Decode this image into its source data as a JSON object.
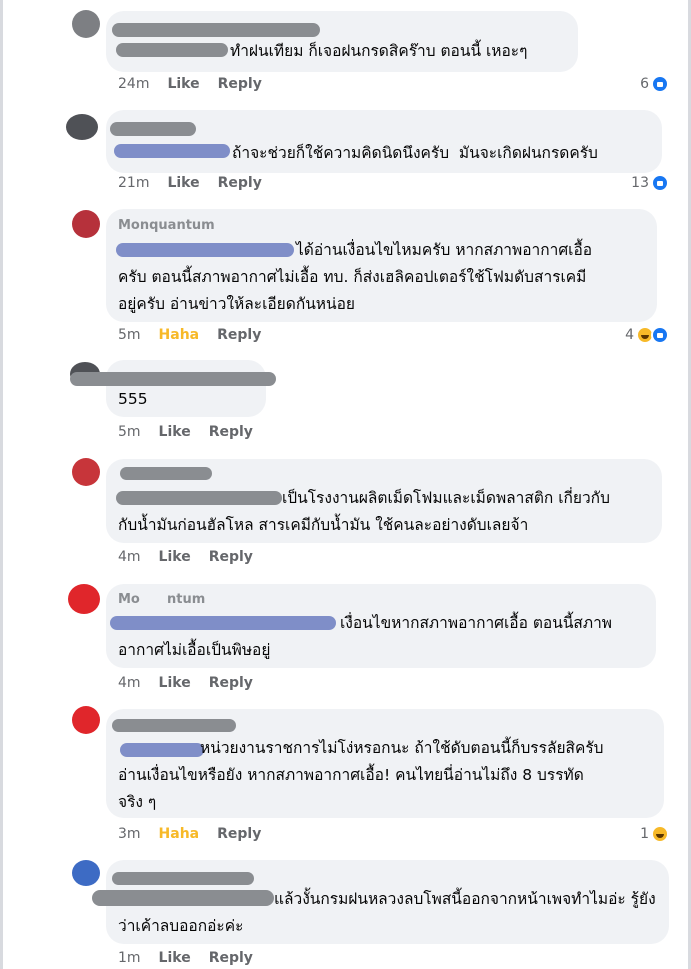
{
  "comments": [
    {
      "lines": [
        "ทำฝนเทียม ก็เจอฝนกรดสิคร๊าบ ตอนนี้ เหอะๆ"
      ],
      "time": "24m",
      "action": "Like",
      "reply": "Reply",
      "reaction_count": "6",
      "reactions": [
        "like-icon"
      ]
    },
    {
      "lines": [
        "ถ้าจะช่วยก็ใช้ความคิดนิดนึงครับ  มันจะเกิดฝนกรดครับ"
      ],
      "time": "21m",
      "action": "Like",
      "reply": "Reply",
      "reaction_count": "13",
      "reactions": [
        "like-icon"
      ]
    },
    {
      "name_visible": "Monquantum",
      "lines": [
        "ได้อ่านเงื่อนไขไหมครับ หากสภาพอากาศเอื้อ",
        "ครับ ตอนนี้สภาพอากาศไม่เอื้อ ทบ. ก็ส่งเฮลิคอปเตอร์ใช้โฟมดับสารเคมี",
        "อยู่ครับ อ่านข่าวให้ละเอียดกันหน่อย"
      ],
      "time": "5m",
      "action": "Haha",
      "reply": "Reply",
      "reaction_count": "4",
      "reactions": [
        "haha-icon",
        "like-icon"
      ]
    },
    {
      "lines": [
        "555"
      ],
      "time": "5m",
      "action": "Like",
      "reply": "Reply",
      "reaction_count": "",
      "reactions": []
    },
    {
      "lines": [
        "เป็นโรงงานผลิตเม็ดโฟมและเม็ดพลาสติก เกี่ยวกับ",
        "กับน้ำมันก่อนฮัลโหล สารเคมีกับน้ำมัน ใช้คนละอย่างดับเลยจ้า"
      ],
      "time": "4m",
      "action": "Like",
      "reply": "Reply",
      "reaction_count": "",
      "reactions": []
    },
    {
      "name_visible": "Mo      ntum",
      "lines": [
        "เงื่อนไขหากสภาพอากาศเอื้อ ตอนนี้สภาพ",
        "อากาศไม่เอื้อเป็นพิษอยู่"
      ],
      "time": "4m",
      "action": "Like",
      "reply": "Reply",
      "reaction_count": "",
      "reactions": []
    },
    {
      "lines": [
        "หน่วยงานราชการไม่โง่หรอกนะ ถ้าใช้ดับตอนนี้ก็บรรลัยสิครับ",
        "อ่านเงื่อนไขหรือยัง หากสภาพอากาศเอื้อ! คนไทยนี่อ่านไม่ถึง 8 บรรทัด",
        "จริง ๆ"
      ],
      "time": "3m",
      "action": "Haha",
      "reply": "Reply",
      "reaction_count": "1",
      "reactions": [
        "haha-icon"
      ]
    },
    {
      "lines": [
        "แล้วงั้นกรมฝนหลวงลบโพสนี้ออกจากหน้าเพจทำไมอ่ะ รู้ยัง",
        "ว่าเค้าลบออกอ่ะค่ะ"
      ],
      "time": "1m",
      "action": "Like",
      "reply": "Reply",
      "reaction_count": "",
      "reactions": []
    }
  ],
  "colors": {
    "like": "#1877f2",
    "haha": "#f7b928",
    "bubble": "#f0f2f5",
    "meta": "#65676b"
  }
}
